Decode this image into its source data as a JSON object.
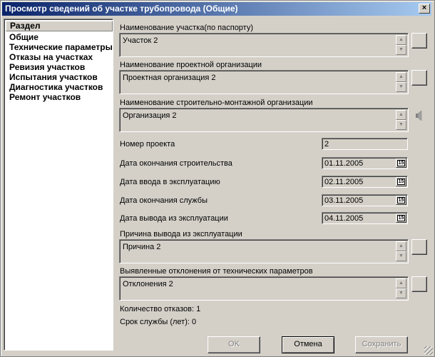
{
  "window": {
    "title": "Просмотр сведений об участке трубопровода (Общие)",
    "close_glyph": "×"
  },
  "sidebar": {
    "header": "Раздел",
    "items": [
      "Общие",
      "Технические параметры",
      "Отказы на участках",
      "Ревизия участков",
      "Испытания участков",
      "Диагностика участков",
      "Ремонт участков"
    ]
  },
  "form": {
    "section_name": {
      "label": "Наименование участка(по паспорту)",
      "value": "Участок 2"
    },
    "design_org": {
      "label": "Наименование проектной организации",
      "value": "Проектная организация 2"
    },
    "construction_org": {
      "label": "Наименование строительно-монтажной организации",
      "value": "Организация 2"
    },
    "project_number": {
      "label": "Номер проекта",
      "value": "2"
    },
    "construction_end": {
      "label": "Дата окончания строительства",
      "value": "01.11.2005"
    },
    "commissioning": {
      "label": "Дата ввода в эксплуатацию",
      "value": "02.11.2005"
    },
    "service_end": {
      "label": "Дата окончания службы",
      "value": "03.11.2005"
    },
    "decommissioning": {
      "label": "Дата вывода из эксплуатации",
      "value": "04.11.2005"
    },
    "decommission_reason": {
      "label": "Причина вывода из эксплуатации",
      "value": "Причина 2"
    },
    "deviations": {
      "label": "Выявленные отклонения от технических параметров",
      "value": "Отклонения 2"
    },
    "failures_count": "Количество отказов: 1",
    "service_life": "Срок службы (лет): 0",
    "calendar_glyph": "15"
  },
  "buttons": {
    "ok": "OK",
    "cancel": "Отмена",
    "save": "Сохранить"
  }
}
